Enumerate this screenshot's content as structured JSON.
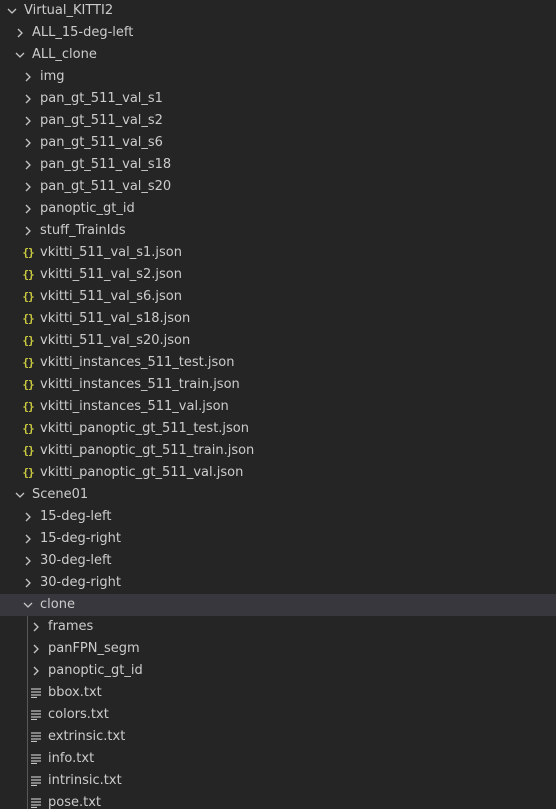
{
  "explorer": {
    "colors": {
      "background": "#252526",
      "selection": "#37373d",
      "text": "#cccccc",
      "json_icon": "#cbcb41",
      "indent_guide": "#585858"
    },
    "items": [
      {
        "label": "Virtual_KITTI2",
        "kind": "folder",
        "expanded": true,
        "depth": 0
      },
      {
        "label": "ALL_15-deg-left",
        "kind": "folder",
        "expanded": false,
        "depth": 1
      },
      {
        "label": "ALL_clone",
        "kind": "folder",
        "expanded": true,
        "depth": 1
      },
      {
        "label": "img",
        "kind": "folder",
        "expanded": false,
        "depth": 2
      },
      {
        "label": "pan_gt_511_val_s1",
        "kind": "folder",
        "expanded": false,
        "depth": 2
      },
      {
        "label": "pan_gt_511_val_s2",
        "kind": "folder",
        "expanded": false,
        "depth": 2
      },
      {
        "label": "pan_gt_511_val_s6",
        "kind": "folder",
        "expanded": false,
        "depth": 2
      },
      {
        "label": "pan_gt_511_val_s18",
        "kind": "folder",
        "expanded": false,
        "depth": 2
      },
      {
        "label": "pan_gt_511_val_s20",
        "kind": "folder",
        "expanded": false,
        "depth": 2
      },
      {
        "label": "panoptic_gt_id",
        "kind": "folder",
        "expanded": false,
        "depth": 2
      },
      {
        "label": "stuff_TrainIds",
        "kind": "folder",
        "expanded": false,
        "depth": 2
      },
      {
        "label": "vkitti_511_val_s1.json",
        "kind": "json",
        "depth": 2
      },
      {
        "label": "vkitti_511_val_s2.json",
        "kind": "json",
        "depth": 2
      },
      {
        "label": "vkitti_511_val_s6.json",
        "kind": "json",
        "depth": 2
      },
      {
        "label": "vkitti_511_val_s18.json",
        "kind": "json",
        "depth": 2
      },
      {
        "label": "vkitti_511_val_s20.json",
        "kind": "json",
        "depth": 2
      },
      {
        "label": "vkitti_instances_511_test.json",
        "kind": "json",
        "depth": 2
      },
      {
        "label": "vkitti_instances_511_train.json",
        "kind": "json",
        "depth": 2
      },
      {
        "label": "vkitti_instances_511_val.json",
        "kind": "json",
        "depth": 2
      },
      {
        "label": "vkitti_panoptic_gt_511_test.json",
        "kind": "json",
        "depth": 2
      },
      {
        "label": "vkitti_panoptic_gt_511_train.json",
        "kind": "json",
        "depth": 2
      },
      {
        "label": "vkitti_panoptic_gt_511_val.json",
        "kind": "json",
        "depth": 2
      },
      {
        "label": "Scene01",
        "kind": "folder",
        "expanded": true,
        "depth": 1
      },
      {
        "label": "15-deg-left",
        "kind": "folder",
        "expanded": false,
        "depth": 2
      },
      {
        "label": "15-deg-right",
        "kind": "folder",
        "expanded": false,
        "depth": 2
      },
      {
        "label": "30-deg-left",
        "kind": "folder",
        "expanded": false,
        "depth": 2
      },
      {
        "label": "30-deg-right",
        "kind": "folder",
        "expanded": false,
        "depth": 2
      },
      {
        "label": "clone",
        "kind": "folder",
        "expanded": true,
        "depth": 2,
        "selected": true
      },
      {
        "label": "frames",
        "kind": "folder",
        "expanded": false,
        "depth": 3
      },
      {
        "label": "panFPN_segm",
        "kind": "folder",
        "expanded": false,
        "depth": 3
      },
      {
        "label": "panoptic_gt_id",
        "kind": "folder",
        "expanded": false,
        "depth": 3
      },
      {
        "label": "bbox.txt",
        "kind": "txt",
        "depth": 3
      },
      {
        "label": "colors.txt",
        "kind": "txt",
        "depth": 3
      },
      {
        "label": "extrinsic.txt",
        "kind": "txt",
        "depth": 3
      },
      {
        "label": "info.txt",
        "kind": "txt",
        "depth": 3
      },
      {
        "label": "intrinsic.txt",
        "kind": "txt",
        "depth": 3
      },
      {
        "label": "pose.txt",
        "kind": "txt",
        "depth": 3
      }
    ]
  }
}
